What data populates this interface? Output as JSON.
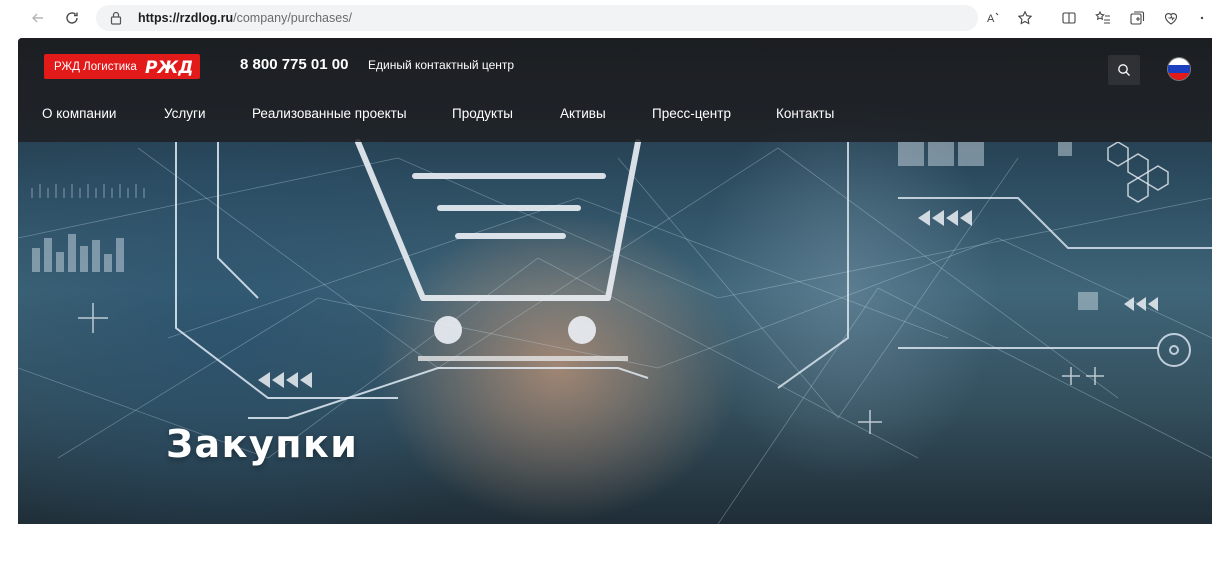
{
  "browser": {
    "url_domain": "https://rzdlog.ru",
    "url_path": "/company/purchases/",
    "icons": [
      "back-icon",
      "refresh-icon",
      "lock-icon",
      "read-aloud-icon",
      "favorite-icon",
      "split-screen-icon",
      "favorites-list-icon",
      "collections-icon",
      "browser-essentials-icon",
      "more-icon"
    ]
  },
  "header": {
    "logo_text": "РЖД Логистика",
    "logo_mark": "РЖД",
    "phone": "8 800 775 01 00",
    "phone_caption": "Единый контактный центр",
    "search_icon": "search-icon",
    "language": "flag-russia-icon"
  },
  "menu": {
    "items": [
      {
        "label": "О компании"
      },
      {
        "label": "Услуги"
      },
      {
        "label": "Реализованные проекты"
      },
      {
        "label": "Продукты"
      },
      {
        "label": "Активы"
      },
      {
        "label": "Пресс-центр"
      },
      {
        "label": "Контакты"
      }
    ]
  },
  "hero": {
    "title": "Закупки",
    "image": "shopping-cart-digital-background"
  },
  "colors": {
    "brand_red": "#e21a1a",
    "header_dark": "#1e2024",
    "text_white": "#ffffff"
  }
}
